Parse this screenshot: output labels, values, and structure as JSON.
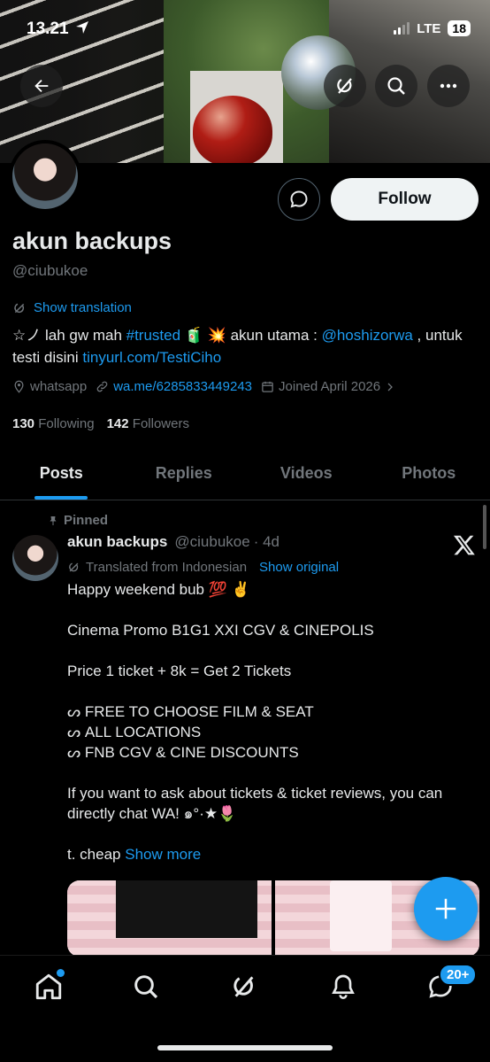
{
  "status_bar": {
    "time": "13.21",
    "network": "LTE",
    "battery": "18"
  },
  "profile": {
    "name": "akun backups",
    "handle": "@ciubukoe",
    "follow_label": "Follow",
    "show_translation": "Show translation",
    "bio": {
      "prefix": "☆ノ lah gw mah ",
      "hashtag": "#trusted",
      "middle": " 🧃 💥 akun utama : ",
      "mention": "@hoshizorwa",
      "mid2": " , untuk testi disini ",
      "url": "tinyurl.com/TestiCiho"
    },
    "location": "whatsapp",
    "website": "wa.me/6285833449243",
    "joined": "Joined April 2026",
    "following_count": "130",
    "following_label": "Following",
    "followers_count": "142",
    "followers_label": "Followers"
  },
  "tabs": [
    {
      "label": "Posts",
      "active": true
    },
    {
      "label": "Replies"
    },
    {
      "label": "Videos"
    },
    {
      "label": "Photos"
    }
  ],
  "tweet": {
    "pinned_label": "Pinned",
    "name": "akun backups",
    "handle": "@ciubukoe",
    "time": "· 4d",
    "translated_from": "Translated from Indonesian",
    "show_original": "Show original",
    "lines": {
      "l1": "Happy weekend bub 💯 ✌️",
      "l2": "Cinema Promo B1G1 XXI CGV & CINEPOLIS",
      "l3": "Price 1 ticket + 8k = Get 2 Tickets",
      "l4": "ᔕ FREE TO CHOOSE FILM & SEAT",
      "l5": "ᔕ  ALL LOCATIONS",
      "l6": "ᔕ  FNB CGV & CINE DISCOUNTS",
      "l7": "If you want to ask about tickets & ticket reviews, you can directly chat WA! ๑°·★🌷",
      "l8": "t. cheap"
    },
    "show_more": "Show more"
  },
  "bottom_nav": {
    "notification_badge": "20+"
  },
  "colors": {
    "accent": "#1d9bf0",
    "background": "#000000",
    "muted": "#71767b"
  }
}
